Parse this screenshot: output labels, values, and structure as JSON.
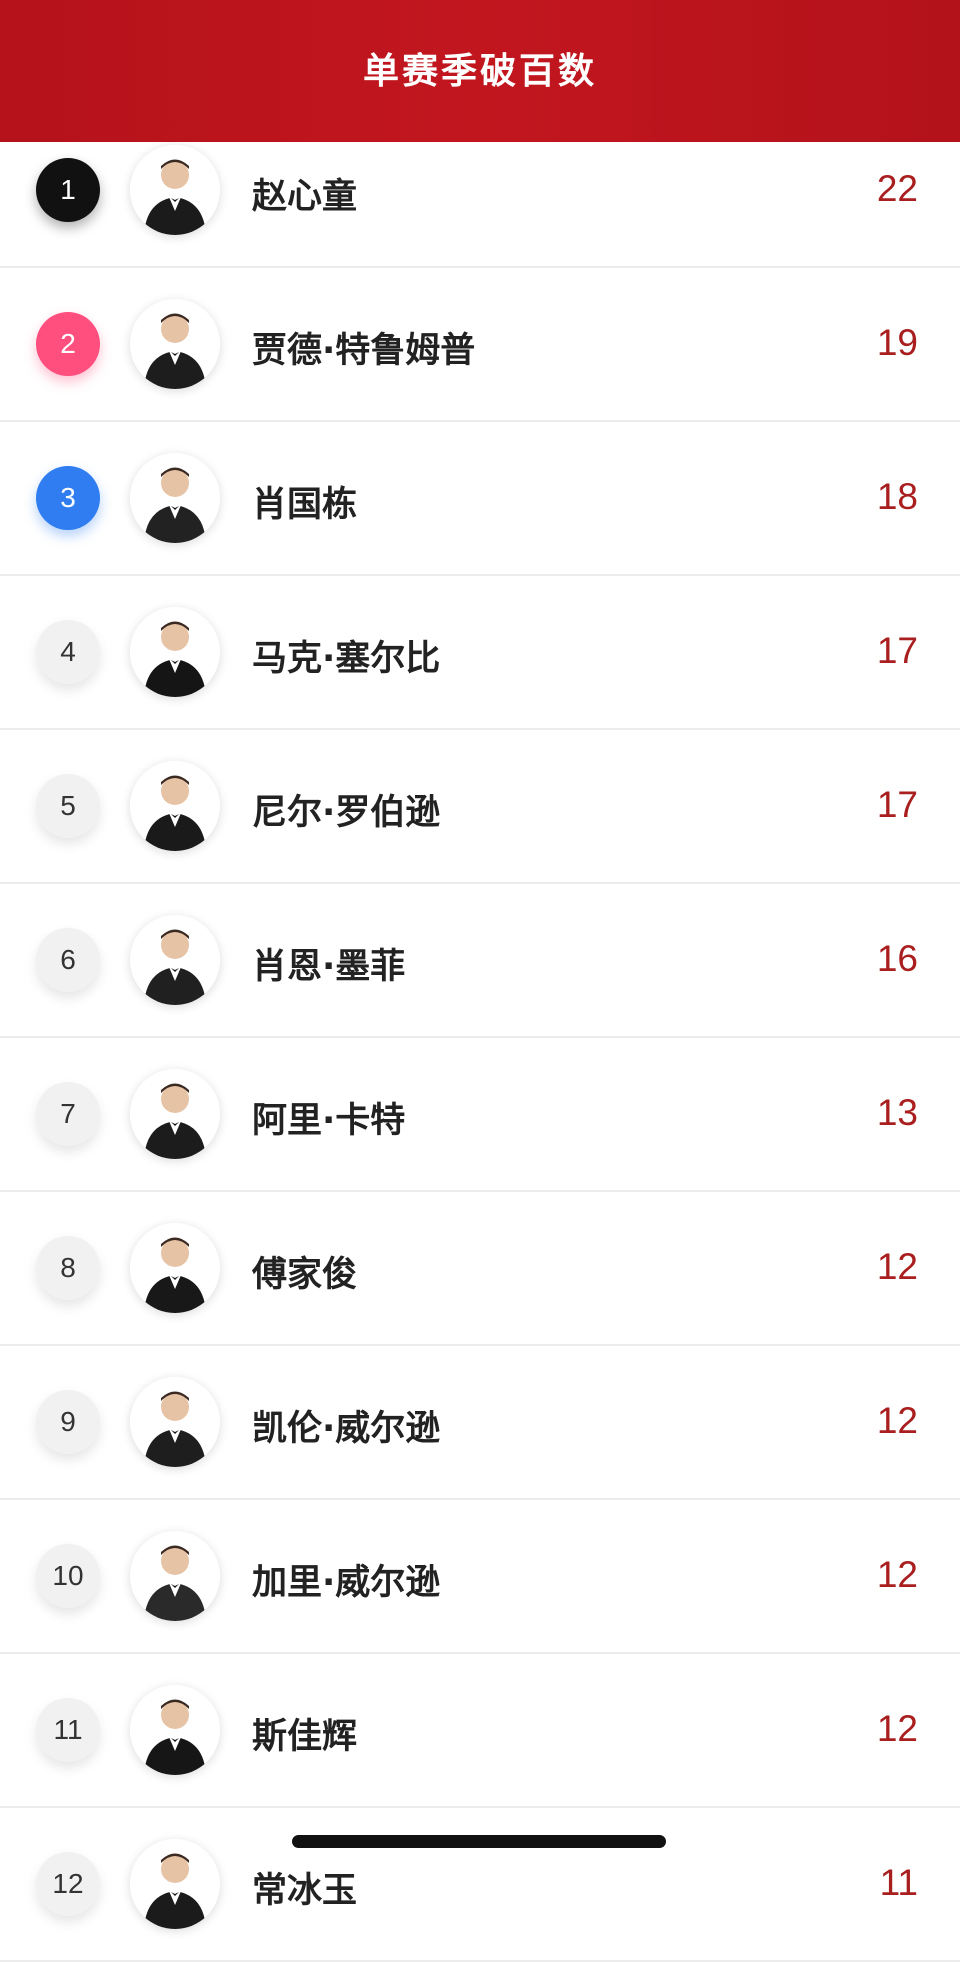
{
  "header": {
    "title": "单赛季破百数"
  },
  "colors": {
    "header_red": "#b5121b",
    "score_red": "#a91e1e",
    "rank1": "#111111",
    "rank2": "#ff4f7f",
    "rank3": "#2f7df0"
  },
  "players": [
    {
      "rank": "1",
      "name": "赵心童",
      "score": "22",
      "avatar_icon": "player-photo"
    },
    {
      "rank": "2",
      "name": "贾德·特鲁姆普",
      "score": "19",
      "avatar_icon": "player-photo"
    },
    {
      "rank": "3",
      "name": "肖国栋",
      "score": "18",
      "avatar_icon": "player-photo"
    },
    {
      "rank": "4",
      "name": "马克·塞尔比",
      "score": "17",
      "avatar_icon": "player-photo"
    },
    {
      "rank": "5",
      "name": "尼尔·罗伯逊",
      "score": "17",
      "avatar_icon": "player-photo"
    },
    {
      "rank": "6",
      "name": "肖恩·墨菲",
      "score": "16",
      "avatar_icon": "player-photo"
    },
    {
      "rank": "7",
      "name": "阿里·卡特",
      "score": "13",
      "avatar_icon": "player-photo"
    },
    {
      "rank": "8",
      "name": "傅家俊",
      "score": "12",
      "avatar_icon": "player-photo"
    },
    {
      "rank": "9",
      "name": "凯伦·威尔逊",
      "score": "12",
      "avatar_icon": "player-photo"
    },
    {
      "rank": "10",
      "name": "加里·威尔逊",
      "score": "12",
      "avatar_icon": "player-photo"
    },
    {
      "rank": "11",
      "name": "斯佳辉",
      "score": "12",
      "avatar_icon": "player-photo"
    },
    {
      "rank": "12",
      "name": "常冰玉",
      "score": "11",
      "avatar_icon": "player-photo"
    }
  ]
}
